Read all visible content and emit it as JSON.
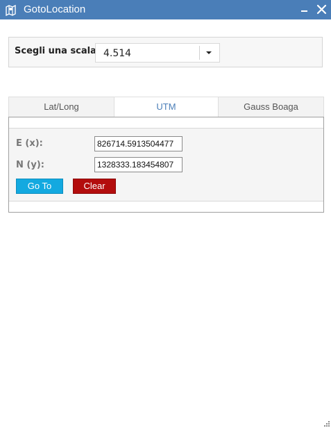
{
  "window": {
    "title": "GotoLocation"
  },
  "scale": {
    "label": "Scegli una scala:",
    "value": "4.514"
  },
  "tabs": [
    {
      "label": "Lat/Long"
    },
    {
      "label": "UTM"
    },
    {
      "label": "Gauss Boaga"
    }
  ],
  "active_tab": "UTM",
  "form": {
    "e_label": "E (x):",
    "e_value": "826714.5913504477",
    "n_label": "N (y):",
    "n_value": "1328333.183454807"
  },
  "buttons": {
    "goto_label": "Go To",
    "clear_label": "Clear"
  },
  "colors": {
    "titlebar": "#4a7eb8",
    "goto_button": "#13a9e0",
    "clear_button": "#b30d0d",
    "active_tab_text": "#4a7eb8"
  },
  "icons": {
    "app": "map-icon",
    "minimize": "minimize-icon",
    "close": "close-icon",
    "dropdown": "chevron-down-icon",
    "resize": "resize-grip-icon"
  }
}
